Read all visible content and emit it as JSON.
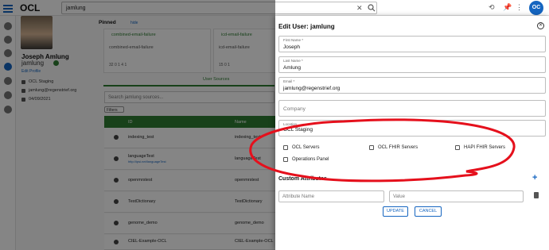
{
  "app": {
    "brand": "OCL",
    "search_value": "jamlung",
    "avatar_initials": "OC",
    "accent": "#1565c0",
    "green": "#2e7d32"
  },
  "toolbar_icons": [
    "history-icon",
    "pin-icon"
  ],
  "profile": {
    "name": "Joseph Amlung",
    "username": "jamlung",
    "edit_label": "Edit Profile",
    "org": "OCL Staging",
    "email": "jamlung@regenstrief.org",
    "date": "04/09/2021"
  },
  "pinned": {
    "heading": "Pinned",
    "hide_label": "hide",
    "cards": [
      {
        "title": "combined-email-failure",
        "desc": "combined-email-failure",
        "stats": "32      0      1     4      1"
      },
      {
        "title": "icd-email-failure",
        "desc": "icd-email-failure",
        "stats": "15      0      1"
      }
    ]
  },
  "sources": {
    "tab_label": "User Sources",
    "search_placeholder": "Search jamlung sources...",
    "filters_label": "Filters",
    "col_id": "ID",
    "col_name": "Name",
    "rows": [
      {
        "id": "indexing_test",
        "url": "",
        "name": "indexing_test"
      },
      {
        "id": "languageTest",
        "url": "http://ipsi.net/languageTest",
        "name": "languageTest"
      },
      {
        "id": "openmrstest",
        "url": "",
        "name": "openmrstest"
      },
      {
        "id": "TestDictionary",
        "url": "",
        "name": "TestDictionary"
      },
      {
        "id": "genome_demo",
        "url": "",
        "name": "genome_demo"
      },
      {
        "id": "CIEL-Example-OCL",
        "url": "",
        "name": "CIEL-Example-OCL"
      }
    ]
  },
  "edit_user": {
    "title": "Edit User: jamlung",
    "fields": {
      "first_name": {
        "label": "First Name *",
        "value": "Joseph"
      },
      "last_name": {
        "label": "Last Name *",
        "value": "Amlung"
      },
      "email": {
        "label": "Email *",
        "value": "jamlung@regenstrief.org"
      },
      "company": {
        "placeholder": "Company"
      },
      "location": {
        "label": "Location",
        "value": "OCL Staging"
      }
    },
    "checkboxes": [
      "OCL Servers",
      "OCL FHIR Servers",
      "HAPI FHIR Servers",
      "Operations Panel"
    ],
    "custom_attributes": "Custom Attributes",
    "attr_name_placeholder": "Attribute Name",
    "value_placeholder": "Value",
    "update_label": "UPDATE",
    "cancel_label": "CANCEL"
  },
  "annotation_color": "#e5101c"
}
